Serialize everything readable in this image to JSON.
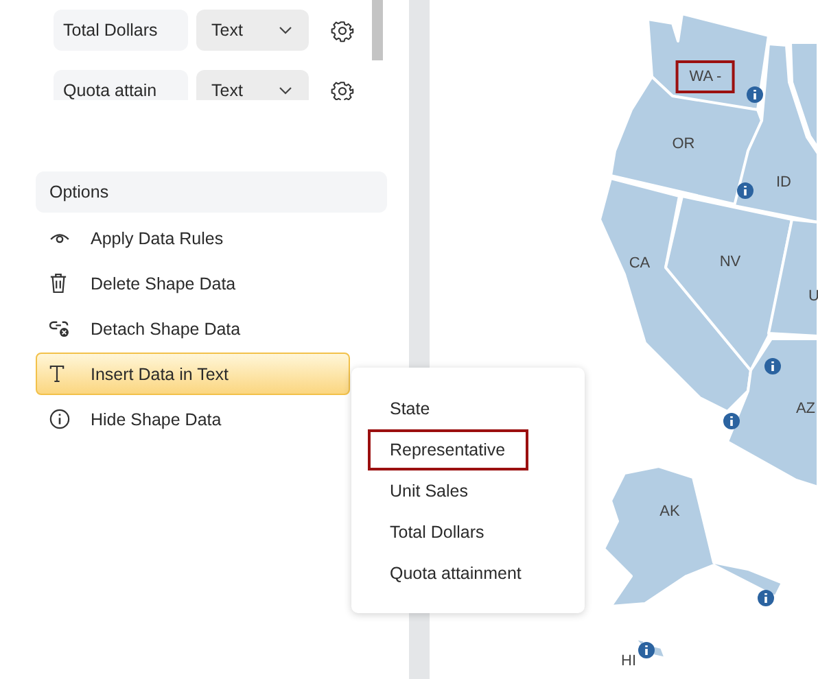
{
  "fields": [
    {
      "name": "Total Dollars",
      "type": "Text"
    },
    {
      "name": "Quota attain",
      "type": "Text"
    }
  ],
  "options": {
    "title": "Options",
    "items": [
      {
        "label": "Apply Data Rules",
        "kind": "rules",
        "selected": false
      },
      {
        "label": "Delete Shape Data",
        "kind": "delete",
        "selected": false
      },
      {
        "label": "Detach Shape Data",
        "kind": "detach",
        "selected": false
      },
      {
        "label": "Insert Data in Text",
        "kind": "insert",
        "selected": true
      },
      {
        "label": "Hide Shape Data",
        "kind": "hide",
        "selected": false
      }
    ]
  },
  "submenu": [
    {
      "label": "State",
      "outlined": false
    },
    {
      "label": "Representative",
      "outlined": true
    },
    {
      "label": "Unit Sales",
      "outlined": false
    },
    {
      "label": "Total Dollars",
      "outlined": false
    },
    {
      "label": "Quota attainment",
      "outlined": false
    }
  ],
  "map": {
    "labels": [
      {
        "text": "WA -",
        "outlined": true
      },
      {
        "text": "OR",
        "outlined": false
      },
      {
        "text": "ID",
        "outlined": false
      },
      {
        "text": "CA",
        "outlined": false
      },
      {
        "text": "NV",
        "outlined": false
      },
      {
        "text": "U",
        "outlined": false
      },
      {
        "text": "AZ",
        "outlined": false
      },
      {
        "text": "AK",
        "outlined": false
      },
      {
        "text": "HI",
        "outlined": false
      }
    ]
  }
}
